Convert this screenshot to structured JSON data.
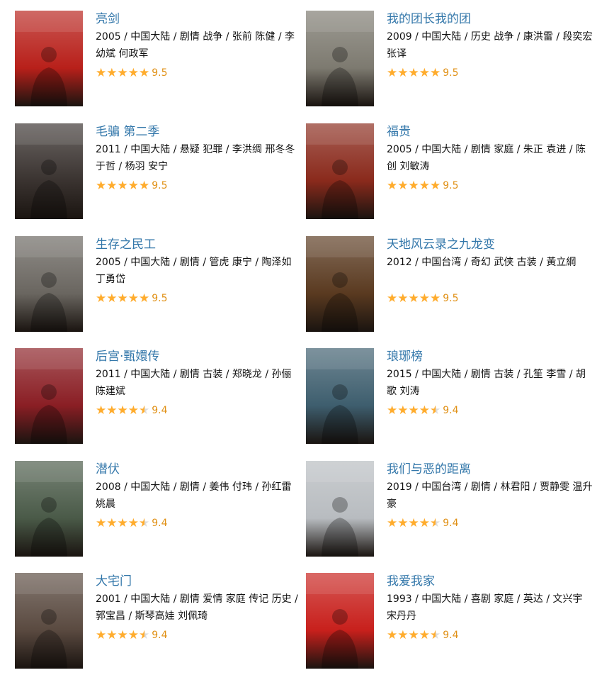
{
  "dramas": [
    {
      "title": "亮剑",
      "meta": "2005 / 中国大陆 / 剧情 战争 / 张前 陈健 / 李幼斌 何政军",
      "score": "9.5",
      "stars_level": 5
    },
    {
      "title": "我的团长我的团",
      "meta": "2009 / 中国大陆 / 历史 战争 / 康洪雷 / 段奕宏 张译",
      "score": "9.5",
      "stars_level": 5
    },
    {
      "title": "毛骗 第二季",
      "meta": "2011 / 中国大陆 / 悬疑 犯罪 / 李洪绸 邢冬冬 于哲 / 杨羽 安宁",
      "score": "9.5",
      "stars_level": 5
    },
    {
      "title": "福贵",
      "meta": "2005 / 中国大陆 / 剧情 家庭 / 朱正 袁进 / 陈创 刘敏涛",
      "score": "9.5",
      "stars_level": 5
    },
    {
      "title": "生存之民工",
      "meta": "2005 / 中国大陆 / 剧情 / 管虎 康宁 / 陶泽如 丁勇岱",
      "score": "9.5",
      "stars_level": 5
    },
    {
      "title": "天地风云录之九龙变",
      "meta": "2012 / 中国台湾 / 奇幻 武侠 古装 / 黃立綱",
      "score": "9.5",
      "stars_level": 5
    },
    {
      "title": "后宫·甄嬛传",
      "meta": "2011 / 中国大陆 / 剧情 古装 / 郑晓龙 / 孙俪 陈建斌",
      "score": "9.4",
      "stars_level": 4.5
    },
    {
      "title": "琅琊榜",
      "meta": "2015 / 中国大陆 / 剧情 古装 / 孔笙 李雪 / 胡歌 刘涛",
      "score": "9.4",
      "stars_level": 4.5
    },
    {
      "title": "潜伏",
      "meta": "2008 / 中国大陆 / 剧情 / 姜伟 付玮 / 孙红雷 姚晨",
      "score": "9.4",
      "stars_level": 4.5
    },
    {
      "title": "我们与恶的距离",
      "meta": "2019 / 中国台湾 / 剧情 / 林君阳 / 贾静雯 温升豪",
      "score": "9.4",
      "stars_level": 4.5
    },
    {
      "title": "大宅门",
      "meta": "2001 / 中国大陆 / 剧情 爱情 家庭 传记 历史 / 郭宝昌 / 斯琴高娃 刘佩琦",
      "score": "9.4",
      "stars_level": 4.5
    },
    {
      "title": "我爱我家",
      "meta": "1993 / 中国大陆 / 喜剧 家庭 / 英达 / 文兴宇 宋丹丹",
      "score": "9.4",
      "stars_level": 4.5
    }
  ],
  "poster_colors": [
    "#b8201a",
    "#7d7a70",
    "#3a3330",
    "#8a2a1c",
    "#6a6660",
    "#5a3a20",
    "#8a1e24",
    "#3e5e6e",
    "#4a5a48",
    "#b8bcc0",
    "#5a4a40",
    "#c8201c"
  ],
  "star_color": "#ffac2d",
  "title_color": "#3377aa",
  "score_color": "#e09015",
  "star_glyph": "★"
}
